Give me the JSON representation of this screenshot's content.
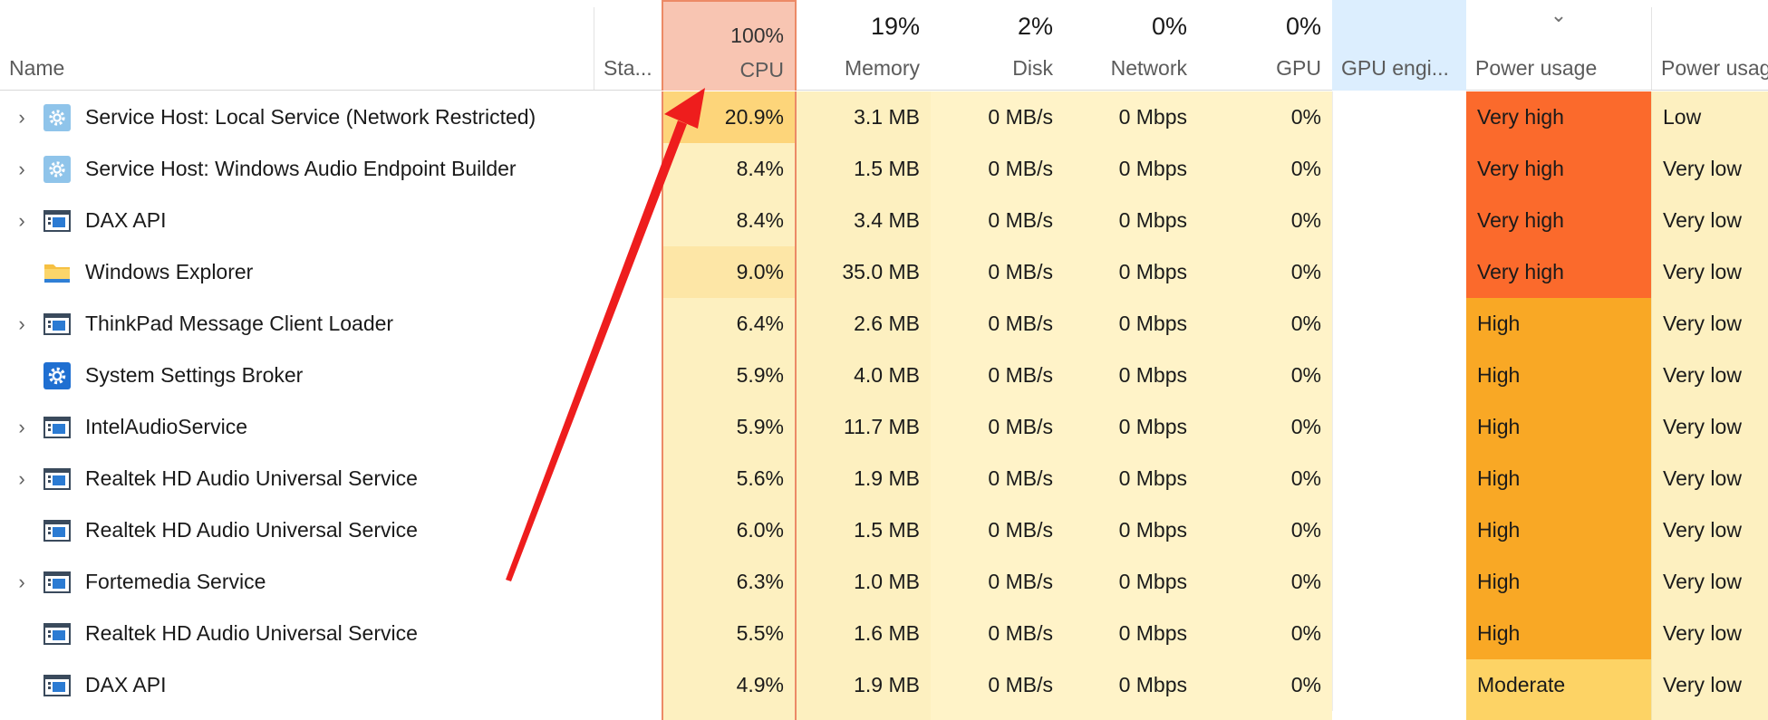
{
  "header": {
    "name_label": "Name",
    "status_label": "Sta...",
    "cpu": {
      "pct": "100%",
      "label": "CPU"
    },
    "memory": {
      "pct": "19%",
      "label": "Memory"
    },
    "disk": {
      "pct": "2%",
      "label": "Disk"
    },
    "network": {
      "pct": "0%",
      "label": "Network"
    },
    "gpu": {
      "pct": "0%",
      "label": "GPU"
    },
    "gpu_engine": {
      "label": "GPU engi..."
    },
    "power_usage": {
      "label": "Power usage"
    },
    "power_usage_trend": {
      "label": "Power usag"
    }
  },
  "colors": {
    "very_high": "#fb6a2c",
    "high": "#f9a825",
    "moderate": "#fdd365",
    "low": "#fdf0c0",
    "cpu_header": "#f8c5b2",
    "arrow": "#ee1d1d"
  },
  "rows": [
    {
      "expandable": true,
      "icon": "gear-service-icon",
      "name": "Service Host: Local Service (Network Restricted)",
      "cpu": "20.9%",
      "cpu_level": "high",
      "memory": "3.1 MB",
      "disk": "0 MB/s",
      "network": "0 Mbps",
      "gpu": "0%",
      "gpu_engine": "",
      "power": "Very high",
      "power_level": "very_high",
      "power_trend": "Low"
    },
    {
      "expandable": true,
      "icon": "gear-service-icon",
      "name": "Service Host: Windows Audio Endpoint Builder",
      "cpu": "8.4%",
      "cpu_level": "low",
      "memory": "1.5 MB",
      "disk": "0 MB/s",
      "network": "0 Mbps",
      "gpu": "0%",
      "gpu_engine": "",
      "power": "Very high",
      "power_level": "very_high",
      "power_trend": "Very low"
    },
    {
      "expandable": true,
      "icon": "app-window-icon",
      "name": "DAX API",
      "cpu": "8.4%",
      "cpu_level": "low",
      "memory": "3.4 MB",
      "disk": "0 MB/s",
      "network": "0 Mbps",
      "gpu": "0%",
      "gpu_engine": "",
      "power": "Very high",
      "power_level": "very_high",
      "power_trend": "Very low"
    },
    {
      "expandable": false,
      "icon": "folder-icon",
      "name": "Windows Explorer",
      "cpu": "9.0%",
      "cpu_level": "mid",
      "memory": "35.0 MB",
      "disk": "0 MB/s",
      "network": "0 Mbps",
      "gpu": "0%",
      "gpu_engine": "",
      "power": "Very high",
      "power_level": "very_high",
      "power_trend": "Very low"
    },
    {
      "expandable": true,
      "icon": "app-window-icon",
      "name": "ThinkPad Message Client Loader",
      "cpu": "6.4%",
      "cpu_level": "low",
      "memory": "2.6 MB",
      "disk": "0 MB/s",
      "network": "0 Mbps",
      "gpu": "0%",
      "gpu_engine": "",
      "power": "High",
      "power_level": "high",
      "power_trend": "Very low"
    },
    {
      "expandable": false,
      "icon": "settings-gear-icon",
      "name": "System Settings Broker",
      "cpu": "5.9%",
      "cpu_level": "low",
      "memory": "4.0 MB",
      "disk": "0 MB/s",
      "network": "0 Mbps",
      "gpu": "0%",
      "gpu_engine": "",
      "power": "High",
      "power_level": "high",
      "power_trend": "Very low"
    },
    {
      "expandable": true,
      "icon": "app-window-icon",
      "name": "IntelAudioService",
      "cpu": "5.9%",
      "cpu_level": "low",
      "memory": "11.7 MB",
      "disk": "0 MB/s",
      "network": "0 Mbps",
      "gpu": "0%",
      "gpu_engine": "",
      "power": "High",
      "power_level": "high",
      "power_trend": "Very low"
    },
    {
      "expandable": true,
      "icon": "app-window-icon",
      "name": "Realtek HD Audio Universal Service",
      "cpu": "5.6%",
      "cpu_level": "low",
      "memory": "1.9 MB",
      "disk": "0 MB/s",
      "network": "0 Mbps",
      "gpu": "0%",
      "gpu_engine": "",
      "power": "High",
      "power_level": "high",
      "power_trend": "Very low"
    },
    {
      "expandable": false,
      "icon": "app-window-icon",
      "name": "Realtek HD Audio Universal Service",
      "cpu": "6.0%",
      "cpu_level": "low",
      "memory": "1.5 MB",
      "disk": "0 MB/s",
      "network": "0 Mbps",
      "gpu": "0%",
      "gpu_engine": "",
      "power": "High",
      "power_level": "high",
      "power_trend": "Very low"
    },
    {
      "expandable": true,
      "icon": "app-window-icon",
      "name": "Fortemedia Service",
      "cpu": "6.3%",
      "cpu_level": "low",
      "memory": "1.0 MB",
      "disk": "0 MB/s",
      "network": "0 Mbps",
      "gpu": "0%",
      "gpu_engine": "",
      "power": "High",
      "power_level": "high",
      "power_trend": "Very low"
    },
    {
      "expandable": false,
      "icon": "app-window-icon",
      "name": "Realtek HD Audio Universal Service",
      "cpu": "5.5%",
      "cpu_level": "low",
      "memory": "1.6 MB",
      "disk": "0 MB/s",
      "network": "0 Mbps",
      "gpu": "0%",
      "gpu_engine": "",
      "power": "High",
      "power_level": "high",
      "power_trend": "Very low"
    },
    {
      "expandable": false,
      "icon": "app-window-icon",
      "name": "DAX API",
      "cpu": "4.9%",
      "cpu_level": "low",
      "memory": "1.9 MB",
      "disk": "0 MB/s",
      "network": "0 Mbps",
      "gpu": "0%",
      "gpu_engine": "",
      "power": "Moderate",
      "power_level": "moderate",
      "power_trend": "Very low"
    }
  ]
}
